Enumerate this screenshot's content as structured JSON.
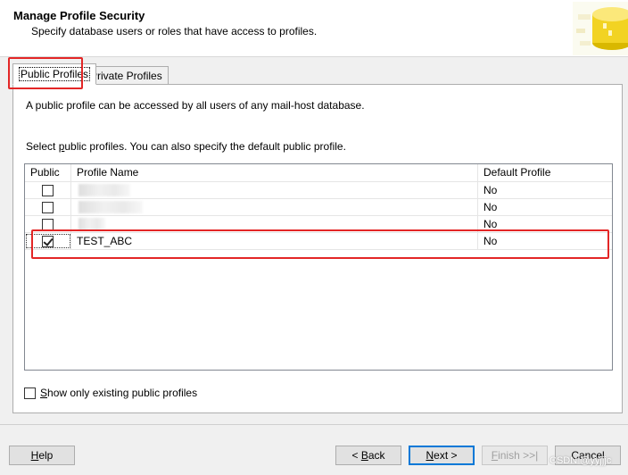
{
  "header": {
    "title": "Manage Profile Security",
    "subtitle": "Specify database users or roles that have access to profiles."
  },
  "tabs": [
    {
      "label": "Public Profiles",
      "selected": true
    },
    {
      "label": "Private Profiles",
      "selected": false
    }
  ],
  "panel": {
    "description": "A public profile can be accessed by all users of any mail-host database.",
    "instruction_pre": "Select ",
    "instruction_u": "p",
    "instruction_post": "ublic profiles. You can also specify the default public profile."
  },
  "grid": {
    "columns": [
      "Public",
      "Profile Name",
      "Default Profile"
    ],
    "rows": [
      {
        "checked": false,
        "name": "",
        "default": "No"
      },
      {
        "checked": false,
        "name": "",
        "default": "No"
      },
      {
        "checked": false,
        "name": "",
        "default": "No"
      },
      {
        "checked": true,
        "name": "TEST_ABC",
        "default": "No"
      }
    ]
  },
  "show_only": {
    "checked": false,
    "label_u": "S",
    "label_rest": "how only existing public profiles"
  },
  "buttons": {
    "help_u": "H",
    "help_rest": "elp",
    "back_pre": "< ",
    "back_u": "B",
    "back_rest": "ack",
    "next_u": "N",
    "next_rest": "ext >",
    "finish_u": "F",
    "finish_rest": "inish >>|",
    "cancel": "Cancel"
  },
  "watermark": "CSDN @yyjjjc",
  "colors": {
    "highlight": "#e32626",
    "accent": "#0078d7"
  },
  "icons": {
    "header": "database-icon"
  }
}
